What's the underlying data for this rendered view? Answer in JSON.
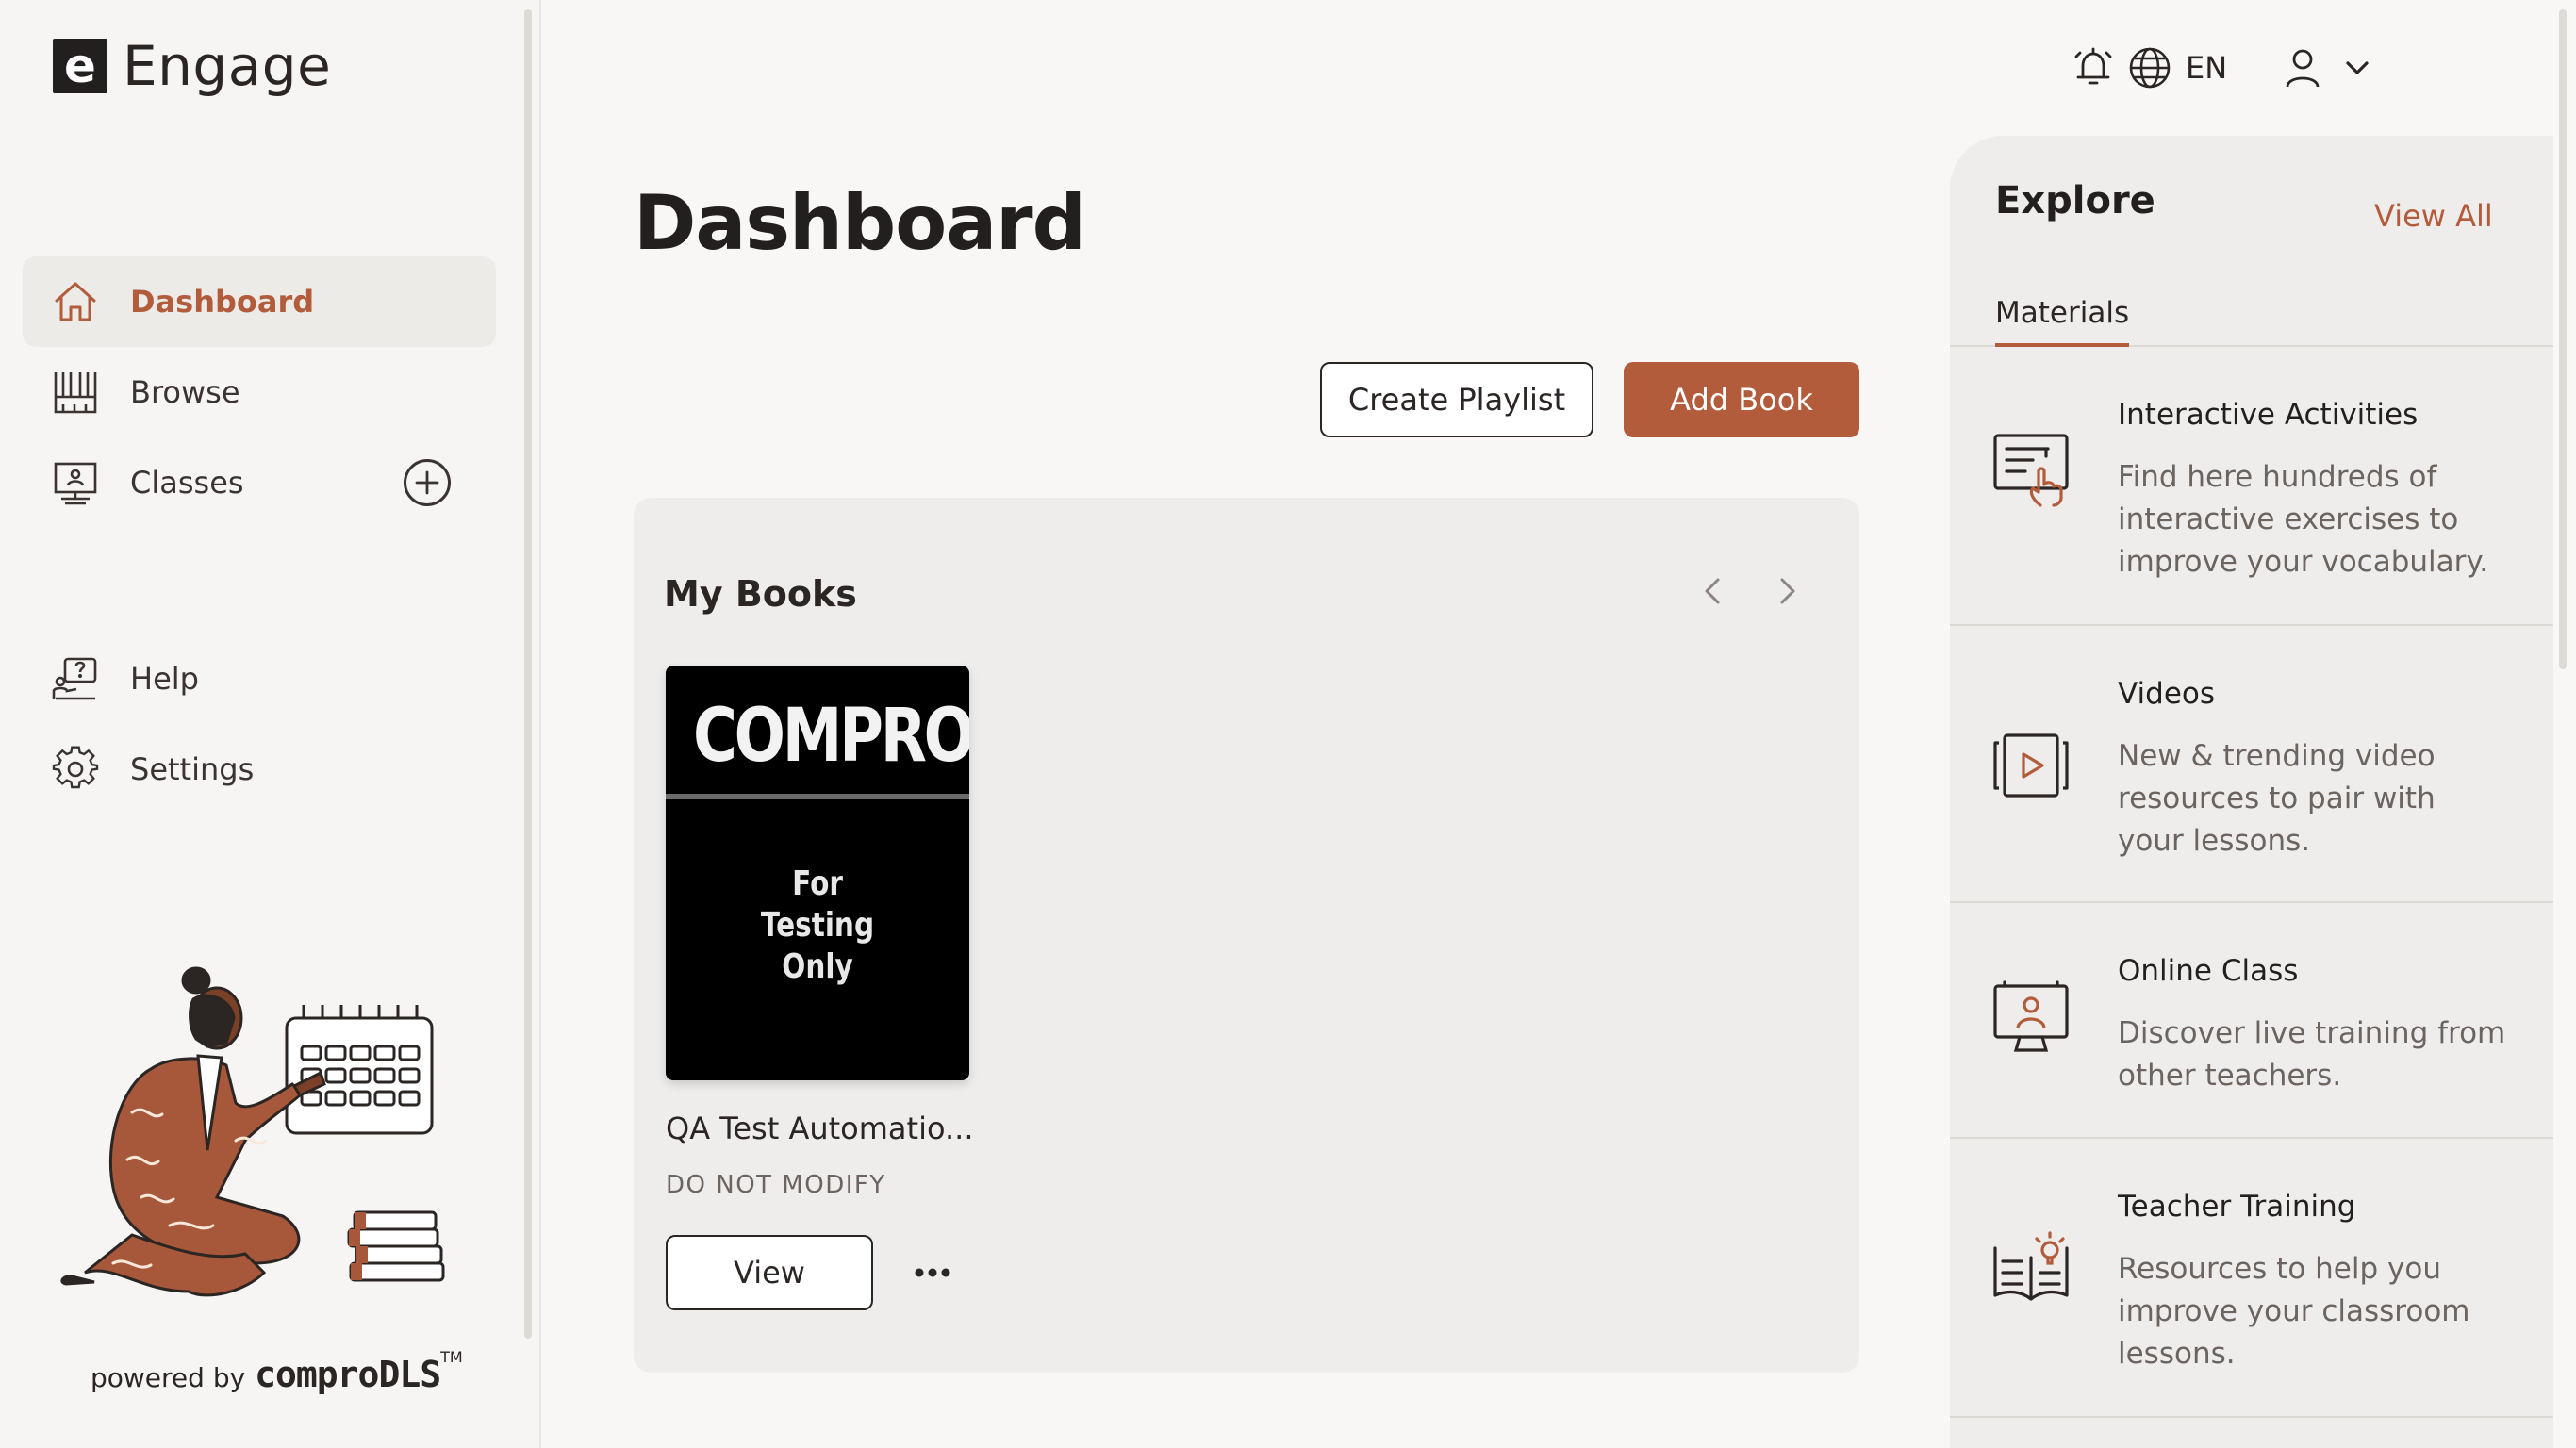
{
  "app": {
    "logo_letter": "e",
    "logo_name": "Engage"
  },
  "sidebar": {
    "items": [
      {
        "label": "Dashboard",
        "icon": "home-icon",
        "active": true
      },
      {
        "label": "Browse",
        "icon": "library-icon"
      },
      {
        "label": "Classes",
        "icon": "classroom-icon"
      },
      {
        "label": "Help",
        "icon": "help-icon"
      },
      {
        "label": "Settings",
        "icon": "gear-icon"
      }
    ],
    "powered_by": "powered by",
    "powered_brand": "comproDLS",
    "trademark": "TM"
  },
  "topbar": {
    "language": "EN"
  },
  "main": {
    "title": "Dashboard",
    "create_playlist": "Create Playlist",
    "add_book": "Add Book",
    "my_books": {
      "title": "My Books",
      "books": [
        {
          "cover_title": "COMPRO",
          "cover_line1": "For",
          "cover_line2": "Testing",
          "cover_line3": "Only",
          "name": "QA Test Automatio...",
          "subtitle": "DO NOT MODIFY",
          "view_label": "View",
          "more_label": "•••"
        }
      ]
    }
  },
  "explore": {
    "title": "Explore",
    "view_all": "View All",
    "tab": "Materials",
    "items": [
      {
        "title": "Interactive Activities",
        "desc_lines": [
          "Find here hundreds of",
          "interactive exercises to",
          "improve your vocabulary."
        ]
      },
      {
        "title": "Videos",
        "desc_lines": [
          "New & trending video",
          "resources to pair with",
          "your lessons."
        ]
      },
      {
        "title": "Online Class",
        "desc_lines": [
          "Discover live training from",
          "other teachers."
        ]
      },
      {
        "title": "Teacher Training",
        "desc_lines": [
          "Resources to help you",
          "improve your classroom",
          "lessons."
        ]
      }
    ]
  },
  "colors": {
    "accent": "#b25c3b",
    "text": "#2b2523",
    "panel": "#efedeb"
  }
}
